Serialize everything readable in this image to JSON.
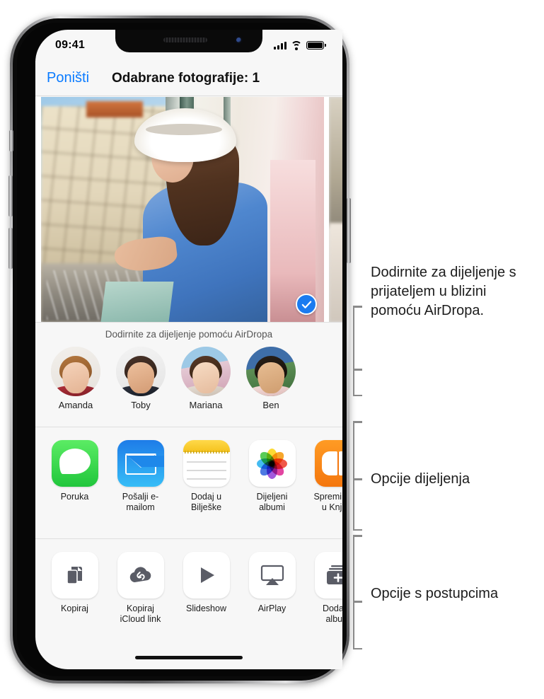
{
  "status_bar": {
    "time": "09:41",
    "signal_icon": "cellular-bars-icon",
    "wifi_icon": "wifi-icon",
    "battery_icon": "battery-full-icon"
  },
  "nav": {
    "cancel_label": "Poništi",
    "title": "Odabrane fotografije: 1"
  },
  "photos": {
    "selected_check_icon": "checkmark-circle-icon",
    "selected_count": "1"
  },
  "airdrop": {
    "hint": "Dodirnite za dijeljenje pomoću AirDropa",
    "contacts": [
      {
        "name": "Amanda",
        "avatar_icon": "avatar-amanda"
      },
      {
        "name": "Toby",
        "avatar_icon": "avatar-toby"
      },
      {
        "name": "Mariana",
        "avatar_icon": "avatar-mariana"
      },
      {
        "name": "Ben",
        "avatar_icon": "avatar-ben"
      }
    ]
  },
  "share_options": [
    {
      "label": "Poruka",
      "icon": "messages-icon"
    },
    {
      "label": "Pošalji\ne-mailom",
      "icon": "mail-icon"
    },
    {
      "label": "Dodaj u\nBilješke",
      "icon": "notes-icon"
    },
    {
      "label": "Dijeljeni\nalbumi",
      "icon": "photos-icon"
    },
    {
      "label": "Spremi PDF u\nKnjige",
      "icon": "books-icon"
    }
  ],
  "action_options": [
    {
      "label": "Kopiraj",
      "icon": "copy-icon"
    },
    {
      "label": "Kopiraj\niCloud link",
      "icon": "icloud-link-icon"
    },
    {
      "label": "Slideshow",
      "icon": "play-icon"
    },
    {
      "label": "AirPlay",
      "icon": "airplay-icon"
    },
    {
      "label": "Dodaj\nu album",
      "icon": "add-to-album-icon"
    }
  ],
  "callouts": [
    {
      "text": "Dodirnite za dijeljenje s prijateljem u blizini pomoću AirDropa."
    },
    {
      "text": "Opcije dijeljenja"
    },
    {
      "text": "Opcije s postupcima"
    }
  ],
  "colors": {
    "accent_blue": "#0a7bff",
    "check_blue": "#1a7bf0",
    "sheet_bg": "#f7f7f7",
    "callout_line": "#8a8a8a"
  }
}
